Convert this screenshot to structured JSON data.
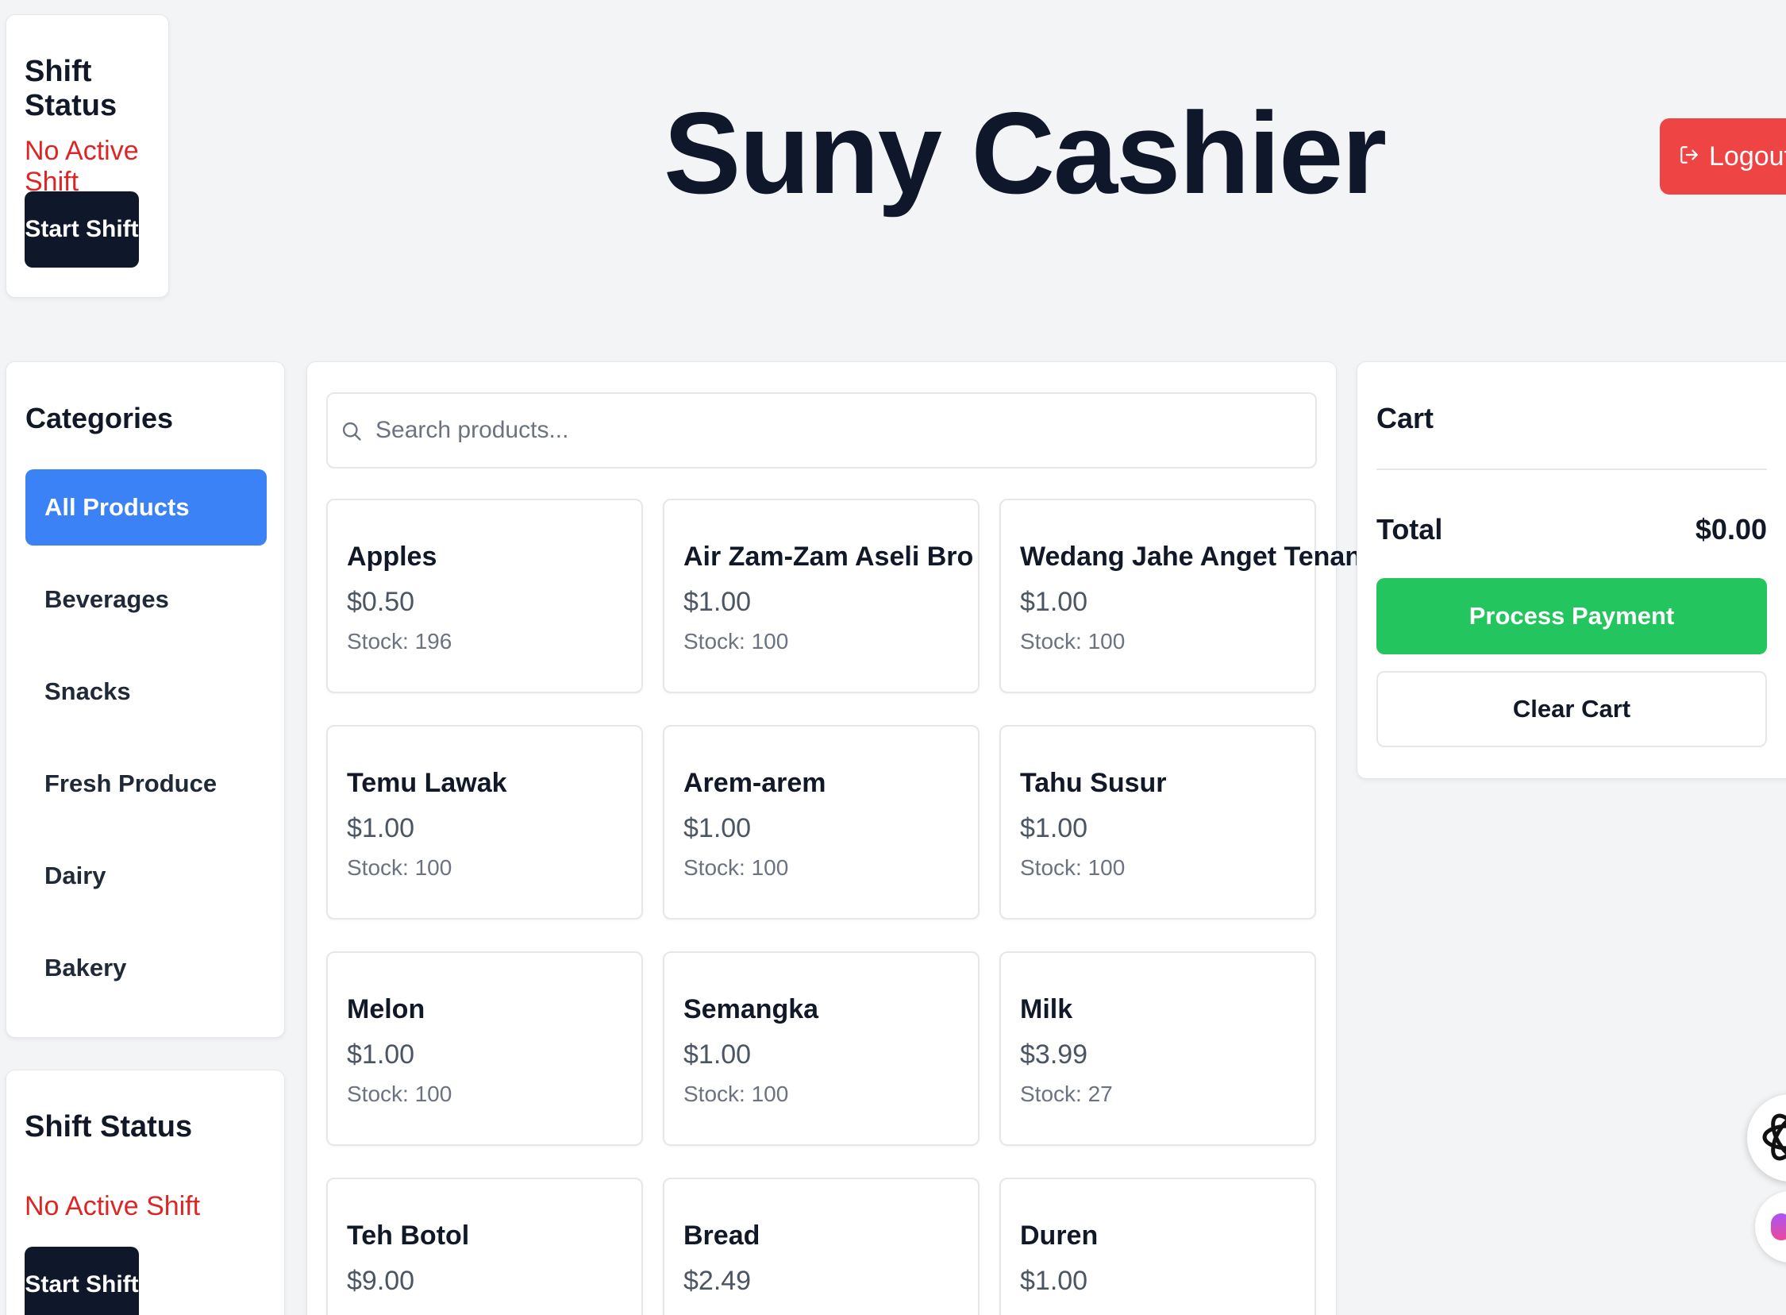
{
  "app": {
    "title": "Suny Cashier"
  },
  "header": {
    "logout_label": "Logout"
  },
  "shift_top": {
    "title": "Shift Status",
    "status": "No Active Shift",
    "button": "Start Shift"
  },
  "shift_bottom": {
    "title": "Shift Status",
    "status": "No Active Shift",
    "button": "Start Shift"
  },
  "categories": {
    "title": "Categories",
    "items": [
      {
        "label": "All Products",
        "active": true
      },
      {
        "label": "Beverages"
      },
      {
        "label": "Snacks"
      },
      {
        "label": "Fresh Produce"
      },
      {
        "label": "Dairy"
      },
      {
        "label": "Bakery"
      }
    ]
  },
  "search": {
    "placeholder": "Search products..."
  },
  "products": [
    {
      "name": "Apples",
      "price": "$0.50",
      "stock": "Stock: 196"
    },
    {
      "name": "Air Zam-Zam Aseli Bro",
      "price": "$1.00",
      "stock": "Stock: 100"
    },
    {
      "name": "Wedang Jahe Anget Tenan Bro",
      "price": "$1.00",
      "stock": "Stock: 100"
    },
    {
      "name": "Temu Lawak",
      "price": "$1.00",
      "stock": "Stock: 100"
    },
    {
      "name": "Arem-arem",
      "price": "$1.00",
      "stock": "Stock: 100"
    },
    {
      "name": "Tahu Susur",
      "price": "$1.00",
      "stock": "Stock: 100"
    },
    {
      "name": "Melon",
      "price": "$1.00",
      "stock": "Stock: 100"
    },
    {
      "name": "Semangka",
      "price": "$1.00",
      "stock": "Stock: 100"
    },
    {
      "name": "Milk",
      "price": "$3.99",
      "stock": "Stock: 27"
    },
    {
      "name": "Teh Botol",
      "price": "$9.00",
      "stock": ""
    },
    {
      "name": "Bread",
      "price": "$2.49",
      "stock": ""
    },
    {
      "name": "Duren",
      "price": "$1.00",
      "stock": ""
    }
  ],
  "cart": {
    "title": "Cart",
    "total_label": "Total",
    "total_value": "$0.00",
    "pay_label": "Process Payment",
    "clear_label": "Clear Cart"
  },
  "colors": {
    "primary": "#3b82f6",
    "danger": "#ef4444",
    "success": "#22c55e",
    "dark": "#0f172a",
    "status_red": "#dc2626"
  },
  "icons": [
    "logout-icon",
    "search-icon",
    "assistant-icon"
  ]
}
